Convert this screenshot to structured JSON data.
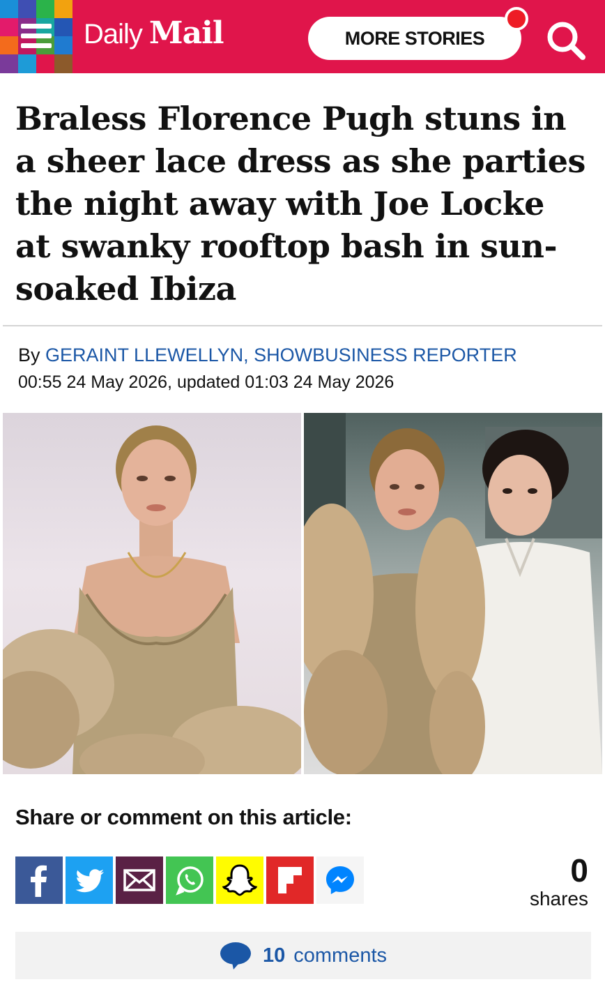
{
  "header": {
    "logo_daily": "Daily",
    "logo_mail": "Mail",
    "more_stories_label": "MORE STORIES",
    "colors": {
      "brand": "#e0154b",
      "notification": "#ee1c25"
    }
  },
  "article": {
    "headline": "Braless Florence Pugh stuns in a sheer lace dress as she parties the night away with Joe Locke at swanky rooftop bash in sun-soaked Ibiza",
    "byline_prefix": "By",
    "author": "GERAINT LLEWELLYN, SHOWBUSINESS REPORTER",
    "dateline": "00:55 24 May 2026, updated 01:03 24 May 2026"
  },
  "share": {
    "title": "Share or comment on this article:",
    "buttons": [
      {
        "icon": "facebook-icon",
        "color": "#3b5998"
      },
      {
        "icon": "twitter-icon",
        "color": "#1da1f2"
      },
      {
        "icon": "email-icon",
        "color": "#5a2145"
      },
      {
        "icon": "whatsapp-icon",
        "color": "#43c553"
      },
      {
        "icon": "snapchat-icon",
        "color": "#fffc00"
      },
      {
        "icon": "flipboard-icon",
        "color": "#e12828"
      },
      {
        "icon": "messenger-icon",
        "color": "#0084ff"
      }
    ],
    "share_count": "0",
    "share_count_label": "shares"
  },
  "comments": {
    "count": "10",
    "label": "comments",
    "color": "#1b57a6"
  }
}
